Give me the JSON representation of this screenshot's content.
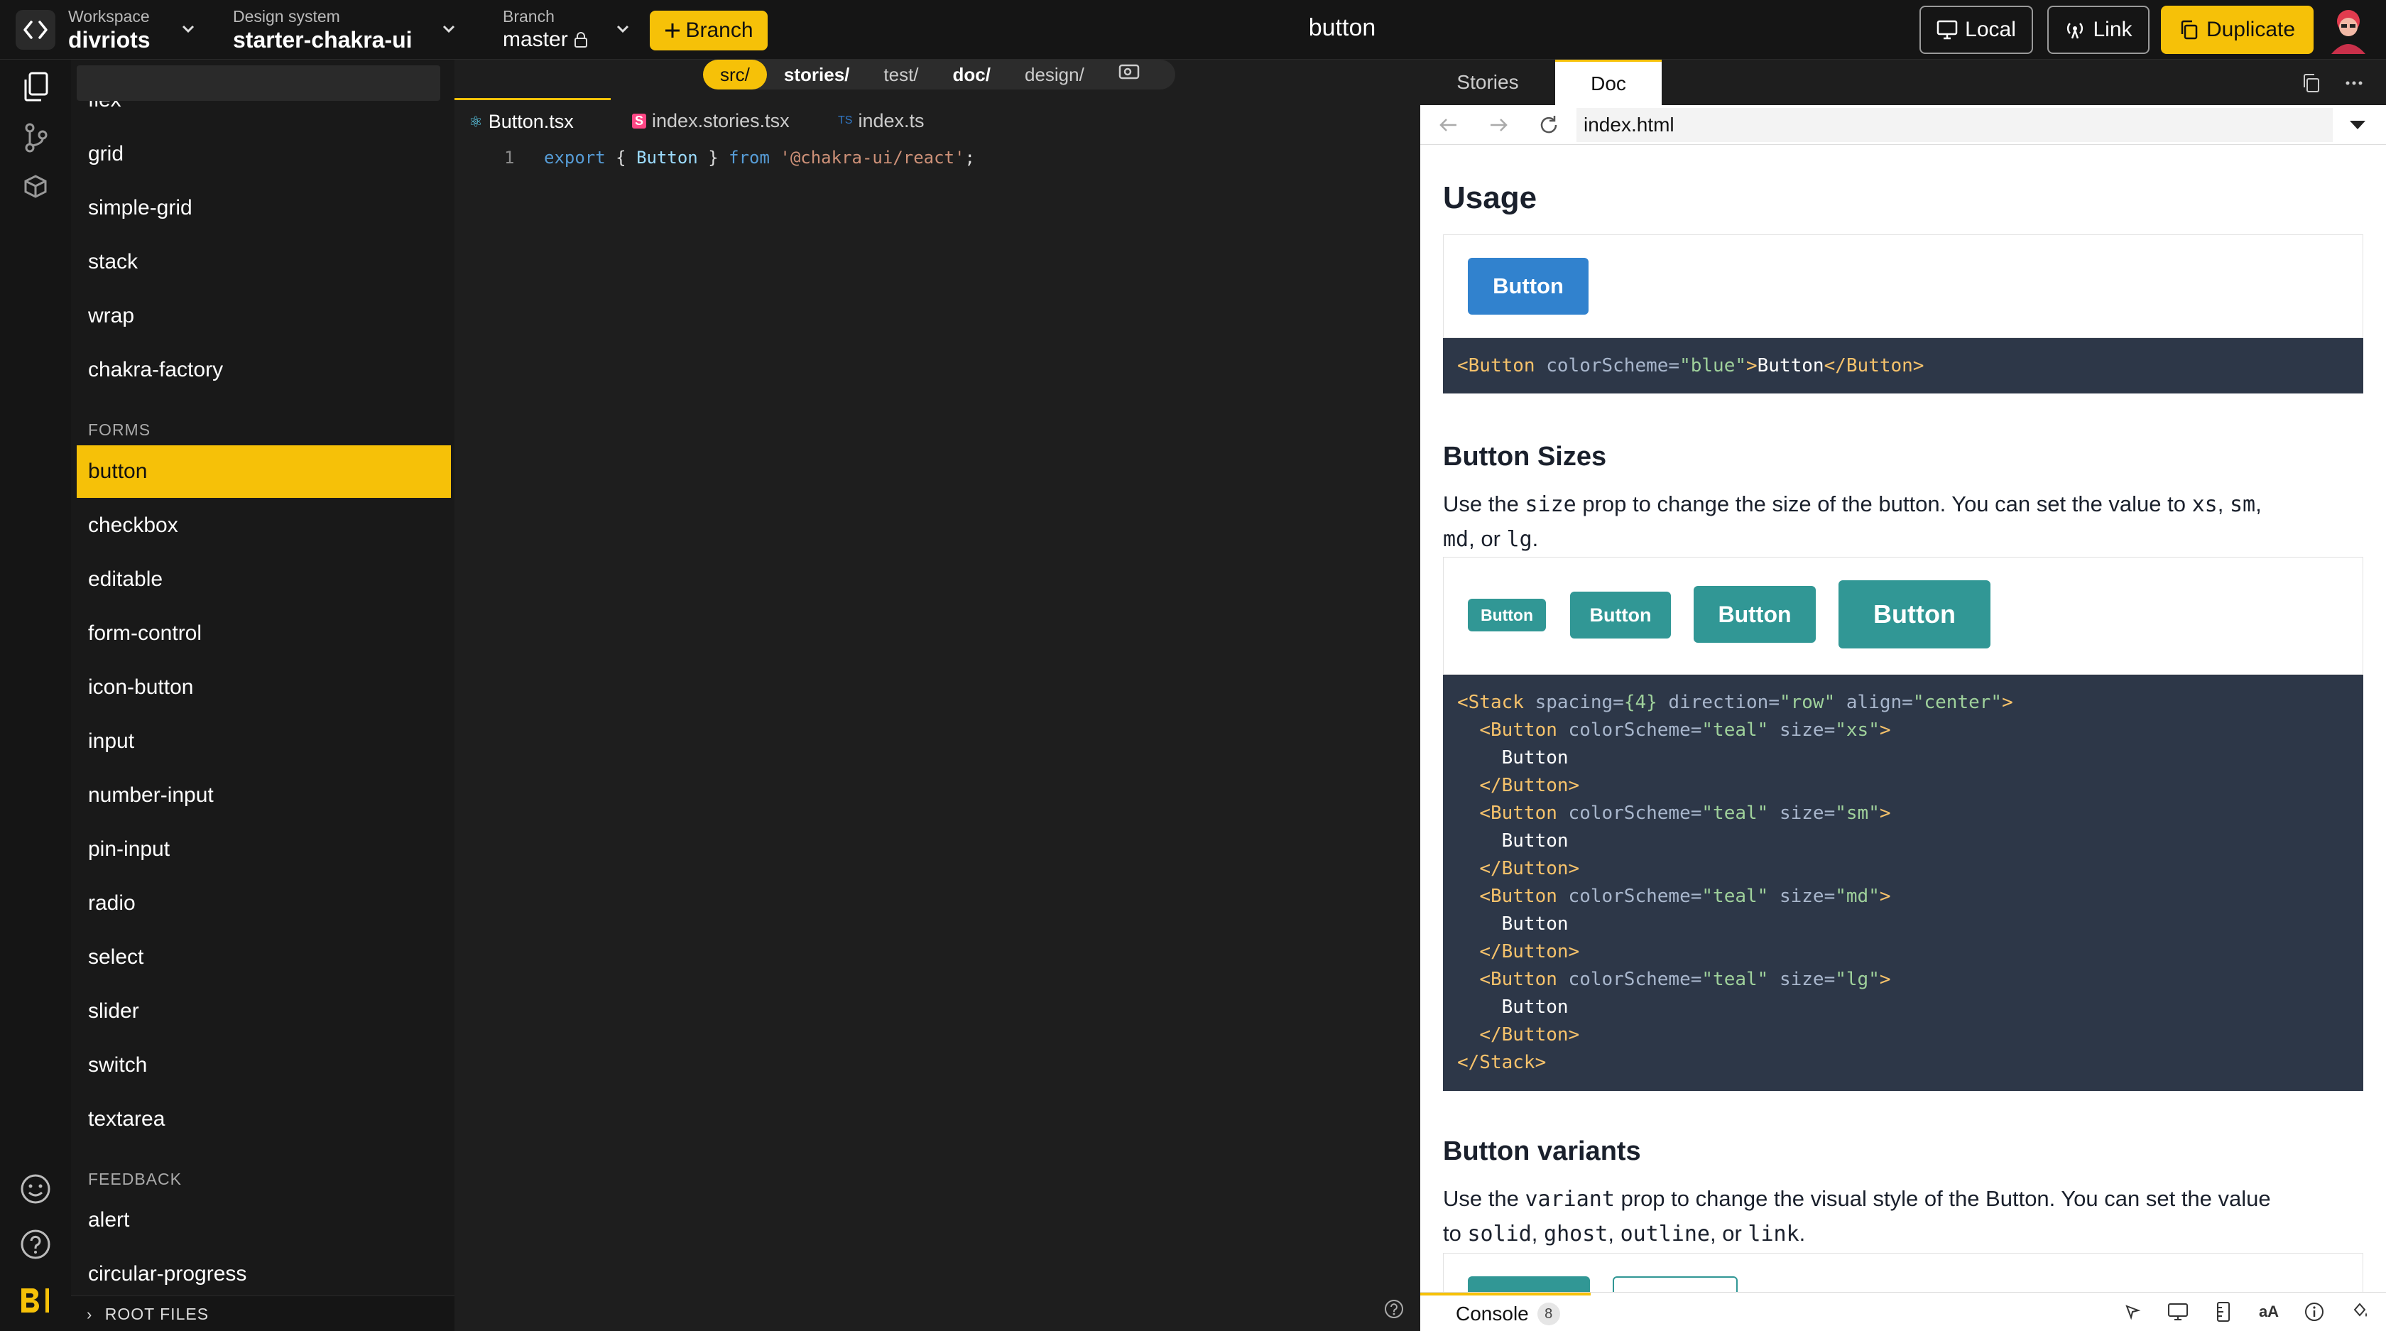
{
  "topbar": {
    "workspace_label": "Workspace",
    "workspace_value": "divriots",
    "design_system_label": "Design system",
    "design_system_value": "starter-chakra-ui",
    "branch_label": "Branch",
    "branch_value": "master",
    "branch_button": "Branch",
    "page_title": "button",
    "local_button": "Local",
    "link_button": "Link",
    "duplicate_button": "Duplicate"
  },
  "sidebar": {
    "partial_item": "flex",
    "items_top": [
      "grid",
      "simple-grid",
      "stack",
      "wrap",
      "chakra-factory"
    ],
    "forms_section": "FORMS",
    "forms_items": [
      "button",
      "checkbox",
      "editable",
      "form-control",
      "icon-button",
      "input",
      "number-input",
      "pin-input",
      "radio",
      "select",
      "slider",
      "switch",
      "textarea"
    ],
    "feedback_section": "FEEDBACK",
    "feedback_items": [
      "alert",
      "circular-progress"
    ],
    "root_files": "ROOT FILES"
  },
  "crumbs": [
    "src/",
    "stories/",
    "test/",
    "doc/",
    "design/"
  ],
  "editor_tabs": [
    {
      "label": "Button.tsx",
      "badge": "⚛"
    },
    {
      "label": "index.stories.tsx",
      "badge": "S"
    },
    {
      "label": "index.ts",
      "badge": "TS"
    }
  ],
  "code": {
    "line_number": "1",
    "kw_export": "export",
    "brace_open": "{",
    "ident": "Button",
    "brace_close": "}",
    "kw_from": "from",
    "module": "'@chakra-ui/react'",
    "semi": ";"
  },
  "preview": {
    "tab_stories": "Stories",
    "tab_doc": "Doc",
    "url": "index.html",
    "usage_title": "Usage",
    "usage_button": "Button",
    "usage_code": {
      "open_tag": "<Button",
      "attr": " colorScheme=",
      "value": "\"blue\"",
      "gt": ">",
      "text": "Button",
      "close_tag": "</Button>"
    },
    "sizes_title": "Button Sizes",
    "sizes_desc_1": "Use the ",
    "sizes_desc_code": "size",
    "sizes_desc_2": " prop to change the size of the button. You can set the value to ",
    "sizes_desc_xs": "xs",
    "sizes_desc_sep1": ", ",
    "sizes_desc_sm": "sm",
    "sizes_desc_sep2": ",",
    "sizes_desc_md": "md",
    "sizes_desc_or": ", or ",
    "sizes_desc_lg": "lg",
    "sizes_desc_end": ".",
    "size_buttons": [
      "Button",
      "Button",
      "Button",
      "Button"
    ],
    "sizes_code": [
      {
        "indent": "",
        "tag": "<Stack",
        "attrs": " spacing=",
        "val": "{4}",
        "attrs2": " direction=",
        "val2": "\"row\"",
        "attrs3": " align=",
        "val3": "\"center\"",
        "end": ">"
      },
      {
        "indent": "  ",
        "tag": "<Button",
        "attrs": " colorScheme=",
        "val": "\"teal\"",
        "attrs2": " size=",
        "val2": "\"xs\"",
        "end": ">"
      },
      {
        "indent": "    ",
        "text": "Button"
      },
      {
        "indent": "  ",
        "tag": "</Button>"
      },
      {
        "indent": "  ",
        "tag": "<Button",
        "attrs": " colorScheme=",
        "val": "\"teal\"",
        "attrs2": " size=",
        "val2": "\"sm\"",
        "end": ">"
      },
      {
        "indent": "    ",
        "text": "Button"
      },
      {
        "indent": "  ",
        "tag": "</Button>"
      },
      {
        "indent": "  ",
        "tag": "<Button",
        "attrs": " colorScheme=",
        "val": "\"teal\"",
        "attrs2": " size=",
        "val2": "\"md\"",
        "end": ">"
      },
      {
        "indent": "    ",
        "text": "Button"
      },
      {
        "indent": "  ",
        "tag": "</Button>"
      },
      {
        "indent": "  ",
        "tag": "<Button",
        "attrs": " colorScheme=",
        "val": "\"teal\"",
        "attrs2": " size=",
        "val2": "\"lg\"",
        "end": ">"
      },
      {
        "indent": "    ",
        "text": "Button"
      },
      {
        "indent": "  ",
        "tag": "</Button>"
      },
      {
        "indent": "",
        "tag": "</Stack>"
      }
    ],
    "variants_title": "Button variants",
    "variants_desc_1": "Use the ",
    "variants_desc_code": "variant",
    "variants_desc_2": " prop to change the visual style of the Button. You can set the value",
    "variants_desc_3": "to ",
    "variants_solid": "solid",
    "variants_ghost": "ghost",
    "variants_outline": "outline",
    "variants_link": "link",
    "variants_sep": ", ",
    "variants_or": ", or ",
    "variants_end": "."
  },
  "console": {
    "label": "Console",
    "count": "8"
  },
  "colors": {
    "accent": "#f6c108",
    "blue_button": "#3182ce",
    "teal_button": "#319795",
    "code_bg": "#2d3748"
  }
}
